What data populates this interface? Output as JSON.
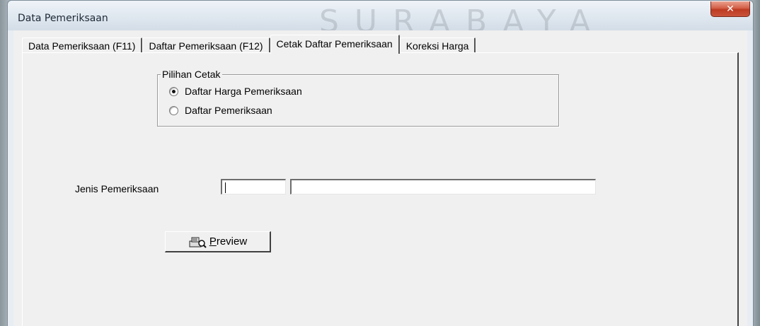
{
  "window": {
    "title": "Data Pemeriksaan",
    "watermark": "SURABAYA",
    "close_glyph": "✕"
  },
  "tabs": [
    {
      "label": "Data Pemeriksaan (F11)",
      "active": false
    },
    {
      "label": "Daftar Pemeriksaan (F12)",
      "active": false
    },
    {
      "label": "Cetak Daftar Pemeriksaan",
      "active": true
    },
    {
      "label": "Koreksi Harga",
      "active": false
    }
  ],
  "print_options": {
    "legend": "Pilihan Cetak",
    "options": [
      {
        "label": "Daftar Harga Pemeriksaan",
        "checked": true
      },
      {
        "label": "Daftar Pemeriksaan",
        "checked": false
      }
    ]
  },
  "filter": {
    "label": "Jenis Pemeriksaan",
    "code_value": "",
    "description_value": ""
  },
  "preview_button": {
    "mnemonic": "P",
    "rest": "review",
    "icon": "printer-preview-icon"
  }
}
